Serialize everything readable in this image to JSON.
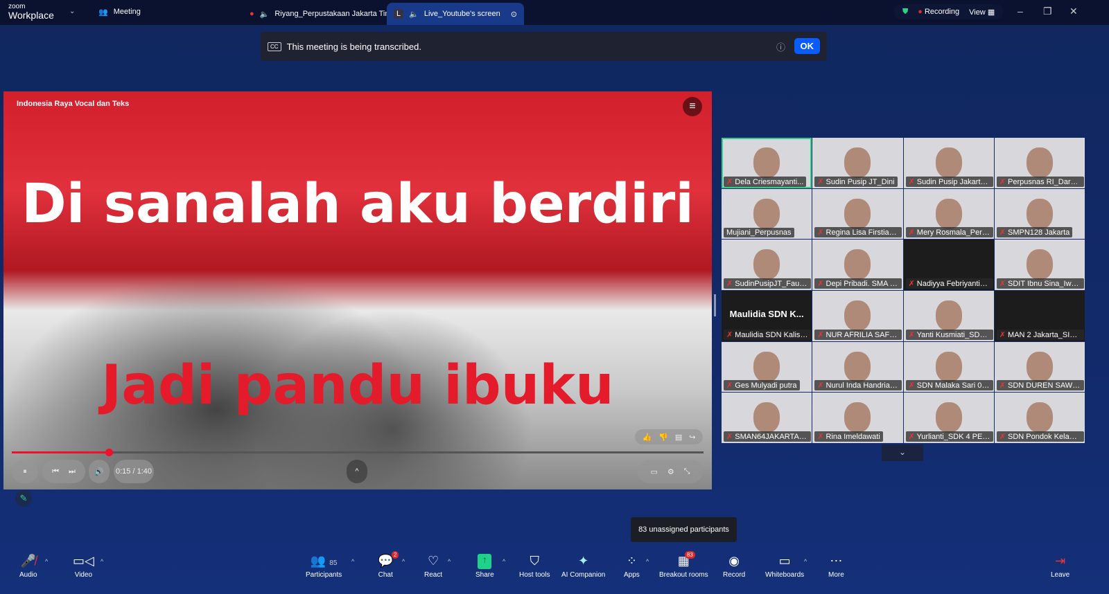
{
  "topbar": {
    "logo_small": "zoom",
    "logo_big": "Workplace",
    "meeting": "Meeting",
    "tabs": [
      {
        "label": "Riyang_Perpustakaan Jakarta Tim"
      },
      {
        "avatar": "L",
        "label": "Live_Youtube's screen"
      }
    ],
    "recording": "Recording",
    "view": "View"
  },
  "banner": {
    "text": "This meeting is being transcribed.",
    "ok": "OK"
  },
  "video": {
    "title": "Indonesia Raya Vocal dan Teks",
    "line1": "Di sanalah aku berdiri",
    "line2": "Jadi pandu ibuku",
    "time": "0:15 / 1:40",
    "progress": 0.14
  },
  "participants": [
    {
      "name": "Dela Criesmayanti...",
      "selected": true
    },
    {
      "name": "Sudin Pusip JT_Dini"
    },
    {
      "name": "Sudin Pusip Jakarta Ti..."
    },
    {
      "name": "Perpusnas RI_Darwan..."
    },
    {
      "name": "Mujiani_Perpusnas",
      "unmuted": true
    },
    {
      "name": "Regina Lisa Firstia_PE..."
    },
    {
      "name": "Mery Rosmala_Perpu..."
    },
    {
      "name": "SMPN128 Jakarta"
    },
    {
      "name": "SudinPusipJT_Fauziah"
    },
    {
      "name": "Depi Pribadi. SMA Pu..."
    },
    {
      "name": "Nadiyya Febriyanti_S...",
      "dark": true
    },
    {
      "name": "SDIT Ibnu Sina_Iwan n..."
    },
    {
      "name": "Maulidia SDN Kalisari...",
      "dark": true,
      "placeholder": "Maulidia  SDN  K..."
    },
    {
      "name": "NUR AFRILIA SAFITRI_..."
    },
    {
      "name": "Yanti Kusmiati_SDN K..."
    },
    {
      "name": "MAN 2 Jakarta_SITI A...",
      "dark": true
    },
    {
      "name": "Ges Mulyadi putra"
    },
    {
      "name": "Nurul Inda Handriani..."
    },
    {
      "name": "SDN Malaka Sari 04_..."
    },
    {
      "name": "SDN DUREN SAWIT 1..."
    },
    {
      "name": "SMAN64JAKARTA_Me..."
    },
    {
      "name": "Rina Imeldawati"
    },
    {
      "name": "Yurlianti_SDK 4 PENA..."
    },
    {
      "name": "SDN Pondok Kelapa..."
    }
  ],
  "tooltip": "83 unassigned participants",
  "toolbar": {
    "audio": "Audio",
    "video": "Video",
    "participants": "Participants",
    "participants_count": "85",
    "chat": "Chat",
    "chat_badge": "2",
    "react": "React",
    "share": "Share",
    "host_tools": "Host tools",
    "ai": "AI Companion",
    "apps": "Apps",
    "breakout": "Breakout rooms",
    "breakout_badge": "83",
    "record": "Record",
    "whiteboards": "Whiteboards",
    "more": "More",
    "leave": "Leave"
  },
  "colors": {
    "accent": "#0b5cff",
    "share": "#1fd18a",
    "recording": "#e02828",
    "selected_tile": "#2fd08a"
  }
}
